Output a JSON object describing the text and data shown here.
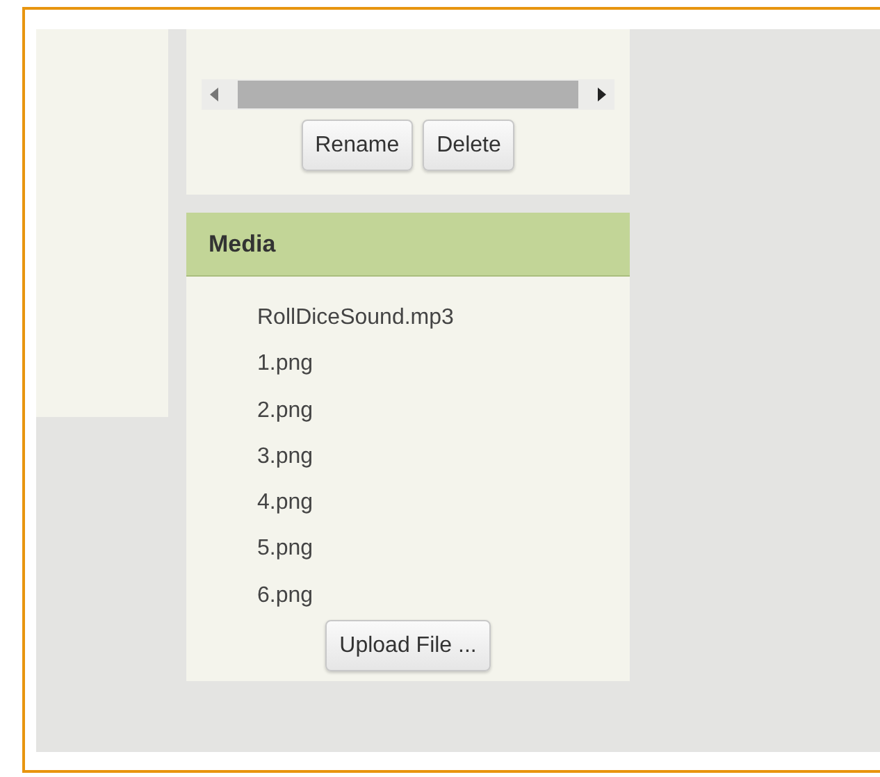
{
  "top_panel": {
    "buttons": [
      "Rename",
      "Delete"
    ]
  },
  "media": {
    "title": "Media",
    "files": [
      "RollDiceSound.mp3",
      "1.png",
      "2.png",
      "3.png",
      "4.png",
      "5.png",
      "6.png"
    ],
    "upload_button": "Upload File ..."
  }
}
